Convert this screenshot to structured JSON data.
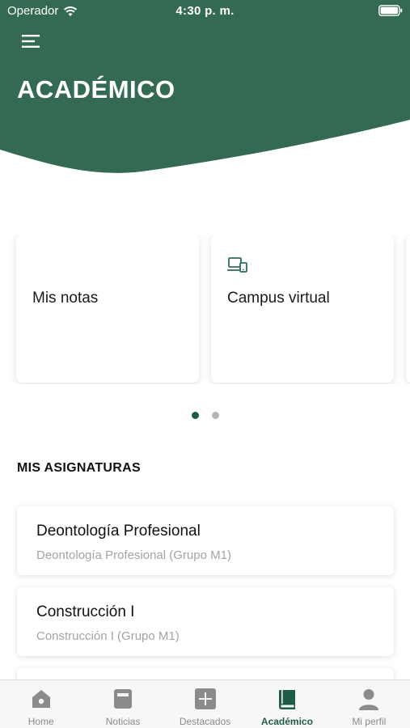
{
  "status_bar": {
    "carrier": "Operador",
    "time": "4:30 p. m."
  },
  "header": {
    "title": "ACADÉMICO",
    "bg_color": "#346a54"
  },
  "carousel": {
    "cards": [
      {
        "label": "Mis notas",
        "icon": ""
      },
      {
        "label": "Campus virtual",
        "icon": "devices-icon"
      }
    ],
    "pages": 2,
    "active_page": 1
  },
  "subjects": {
    "heading": "MIS ASIGNATURAS",
    "items": [
      {
        "title": "Deontología Profesional",
        "subtitle": "Deontología Profesional (Grupo M1)"
      },
      {
        "title": "Construcción I",
        "subtitle": "Construcción I (Grupo M1)"
      }
    ]
  },
  "tabbar": {
    "items": [
      {
        "label": "Home",
        "icon": "home-icon"
      },
      {
        "label": "Noticias",
        "icon": "news-icon"
      },
      {
        "label": "Destacados",
        "icon": "plus-icon"
      },
      {
        "label": "Académico",
        "icon": "book-icon",
        "active": true
      },
      {
        "label": "Mi perfil",
        "icon": "person-icon"
      }
    ],
    "active_color": "#1e5c45",
    "inactive_color": "#8b8b8b"
  }
}
